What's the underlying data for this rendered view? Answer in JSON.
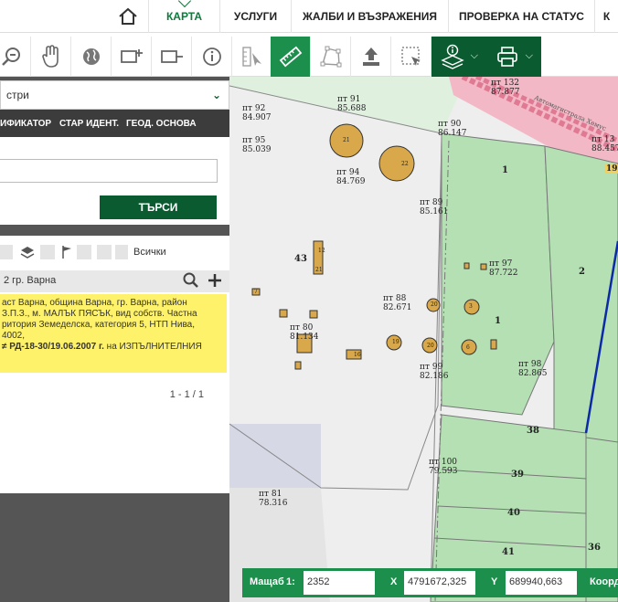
{
  "nav": {
    "items": [
      {
        "label": "КАРТА"
      },
      {
        "label": "УСЛУГИ"
      },
      {
        "label": "ЖАЛБИ И ВЪЗРАЖЕНИЯ"
      },
      {
        "label": "ПРОВЕРКА НА СТАТУС"
      },
      {
        "label": "К"
      }
    ]
  },
  "toolbar": {
    "icons": [
      "zoom-icon",
      "pan-hand-icon",
      "globe-icon",
      "add-layer-icon",
      "remove-layer-icon",
      "info-icon",
      "coordinate-icon",
      "ruler-icon",
      "polygon-icon",
      "upload-icon",
      "select-area-icon",
      "layers-info-icon",
      "print-icon"
    ]
  },
  "left": {
    "register_select": "стри",
    "tabs": [
      "ИФИКАТОР",
      "СТАР ИДЕНТ.",
      "ГЕОД. ОСНОВА"
    ],
    "search_button": "ТЪРСИ",
    "filter_all": "Всички",
    "result_header": "2 гр. Варна",
    "result_lines": [
      "аст Варна, община Варна, гр. Варна, район",
      "З.П.З., м. МАЛЪК ПЯСЪК, вид собств. Частна",
      "ритория Земеделска, категория 5, НТП Нива,",
      "4002,"
    ],
    "result_doc_bold": "≠ РД-18-30/19.06.2007 г.",
    "result_doc_tail": " на ИЗПЪЛНИТЕЛНИЯ",
    "pagination": "1 - 1 / 1"
  },
  "map": {
    "points": [
      {
        "label": "пт",
        "id": "92",
        "value": "84.907"
      },
      {
        "label": "пт",
        "id": "91",
        "value": "85.688"
      },
      {
        "label": "пт",
        "id": "90",
        "value": "86.147"
      },
      {
        "label": "пт",
        "id": "95",
        "value": "85.039"
      },
      {
        "label": "пт",
        "id": "94",
        "value": "84.769"
      },
      {
        "label": "пт",
        "id": "89",
        "value": "85.161"
      },
      {
        "label": "пт",
        "id": "97",
        "value": "87.722"
      },
      {
        "label": "пт",
        "id": "88",
        "value": "82.671"
      },
      {
        "label": "пт",
        "id": "80",
        "value": "81.134"
      },
      {
        "label": "пт",
        "id": "99",
        "value": "82.186"
      },
      {
        "label": "пт",
        "id": "98",
        "value": "82.865"
      },
      {
        "label": "пт",
        "id": "100",
        "value": "79.593"
      },
      {
        "label": "пт",
        "id": "81",
        "value": "78.316"
      },
      {
        "label": "пт",
        "id": "132",
        "value": "87.877"
      },
      {
        "label": "пт",
        "id": "13",
        "value": "88.457"
      }
    ],
    "parcels": [
      "43",
      "1",
      "2",
      "1",
      "38",
      "39",
      "40",
      "41",
      "36",
      "19"
    ],
    "buildings": [
      "21",
      "22",
      "12",
      "21",
      "20",
      "5",
      "11",
      "16",
      "19",
      "7",
      "6",
      "20",
      "3",
      "10"
    ],
    "road_label": "Автомагистрала Хемус"
  },
  "status": {
    "scale_label": "Мащаб",
    "scale_prefix": "1:",
    "scale_value": "2352",
    "x_label": "X",
    "x_value": "4791672,325",
    "y_label": "Y",
    "y_value": "689940,663",
    "coord_label": "Коорд"
  },
  "colors": {
    "accent": "#1d8f4c",
    "accent_dark": "#0a5c30",
    "result_highlight": "#fff26b",
    "parcel_green": "#a8dca8",
    "building_fill": "#d9a84a"
  }
}
